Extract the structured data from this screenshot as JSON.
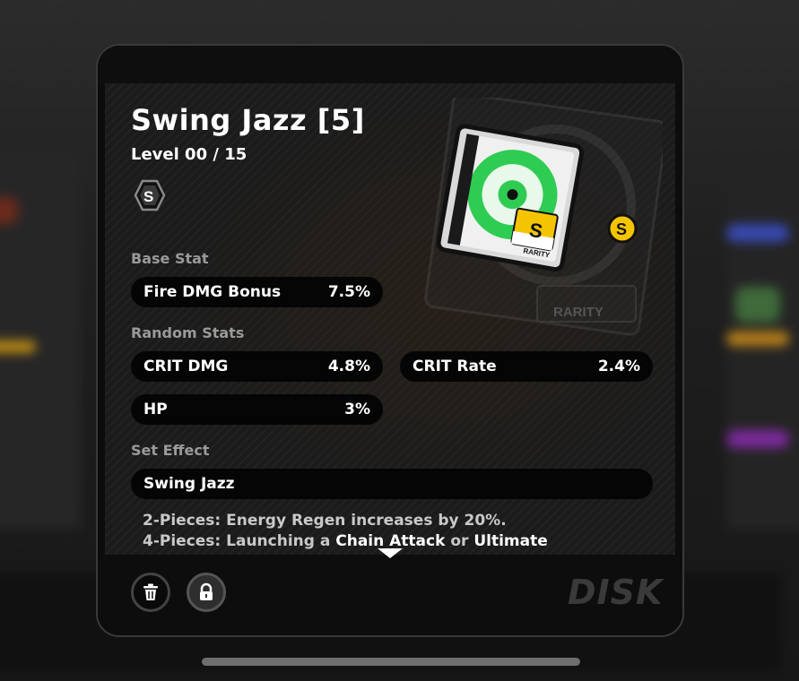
{
  "disc": {
    "title": "Swing Jazz [5]",
    "level": "Level 00 / 15",
    "rank": "S"
  },
  "base_stat": {
    "label": "Base Stat",
    "name": "Fire DMG Bonus",
    "value": "7.5%"
  },
  "random_stats": {
    "label": "Random Stats",
    "items": [
      {
        "name": "CRIT DMG",
        "value": "4.8%"
      },
      {
        "name": "CRIT Rate",
        "value": "2.4%"
      },
      {
        "name": "HP",
        "value": "3%"
      }
    ]
  },
  "set_effect": {
    "label": "Set Effect",
    "name": "Swing Jazz",
    "two_piece": "2-Pieces: Energy Regen increases by 20%.",
    "four_piece_prefix": "4-Pieces: Launching a ",
    "four_piece_kw1": "Chain Attack",
    "four_piece_mid": " or ",
    "four_piece_kw2": "Ultimate"
  },
  "art": {
    "rarity_label": "RARITY",
    "rarity_letter": "S",
    "corner_badge": "S"
  },
  "footer": {
    "tab_label": "DISK"
  },
  "colors": {
    "accent_green": "#2ecc52",
    "rarity_gold": "#f5c400"
  }
}
